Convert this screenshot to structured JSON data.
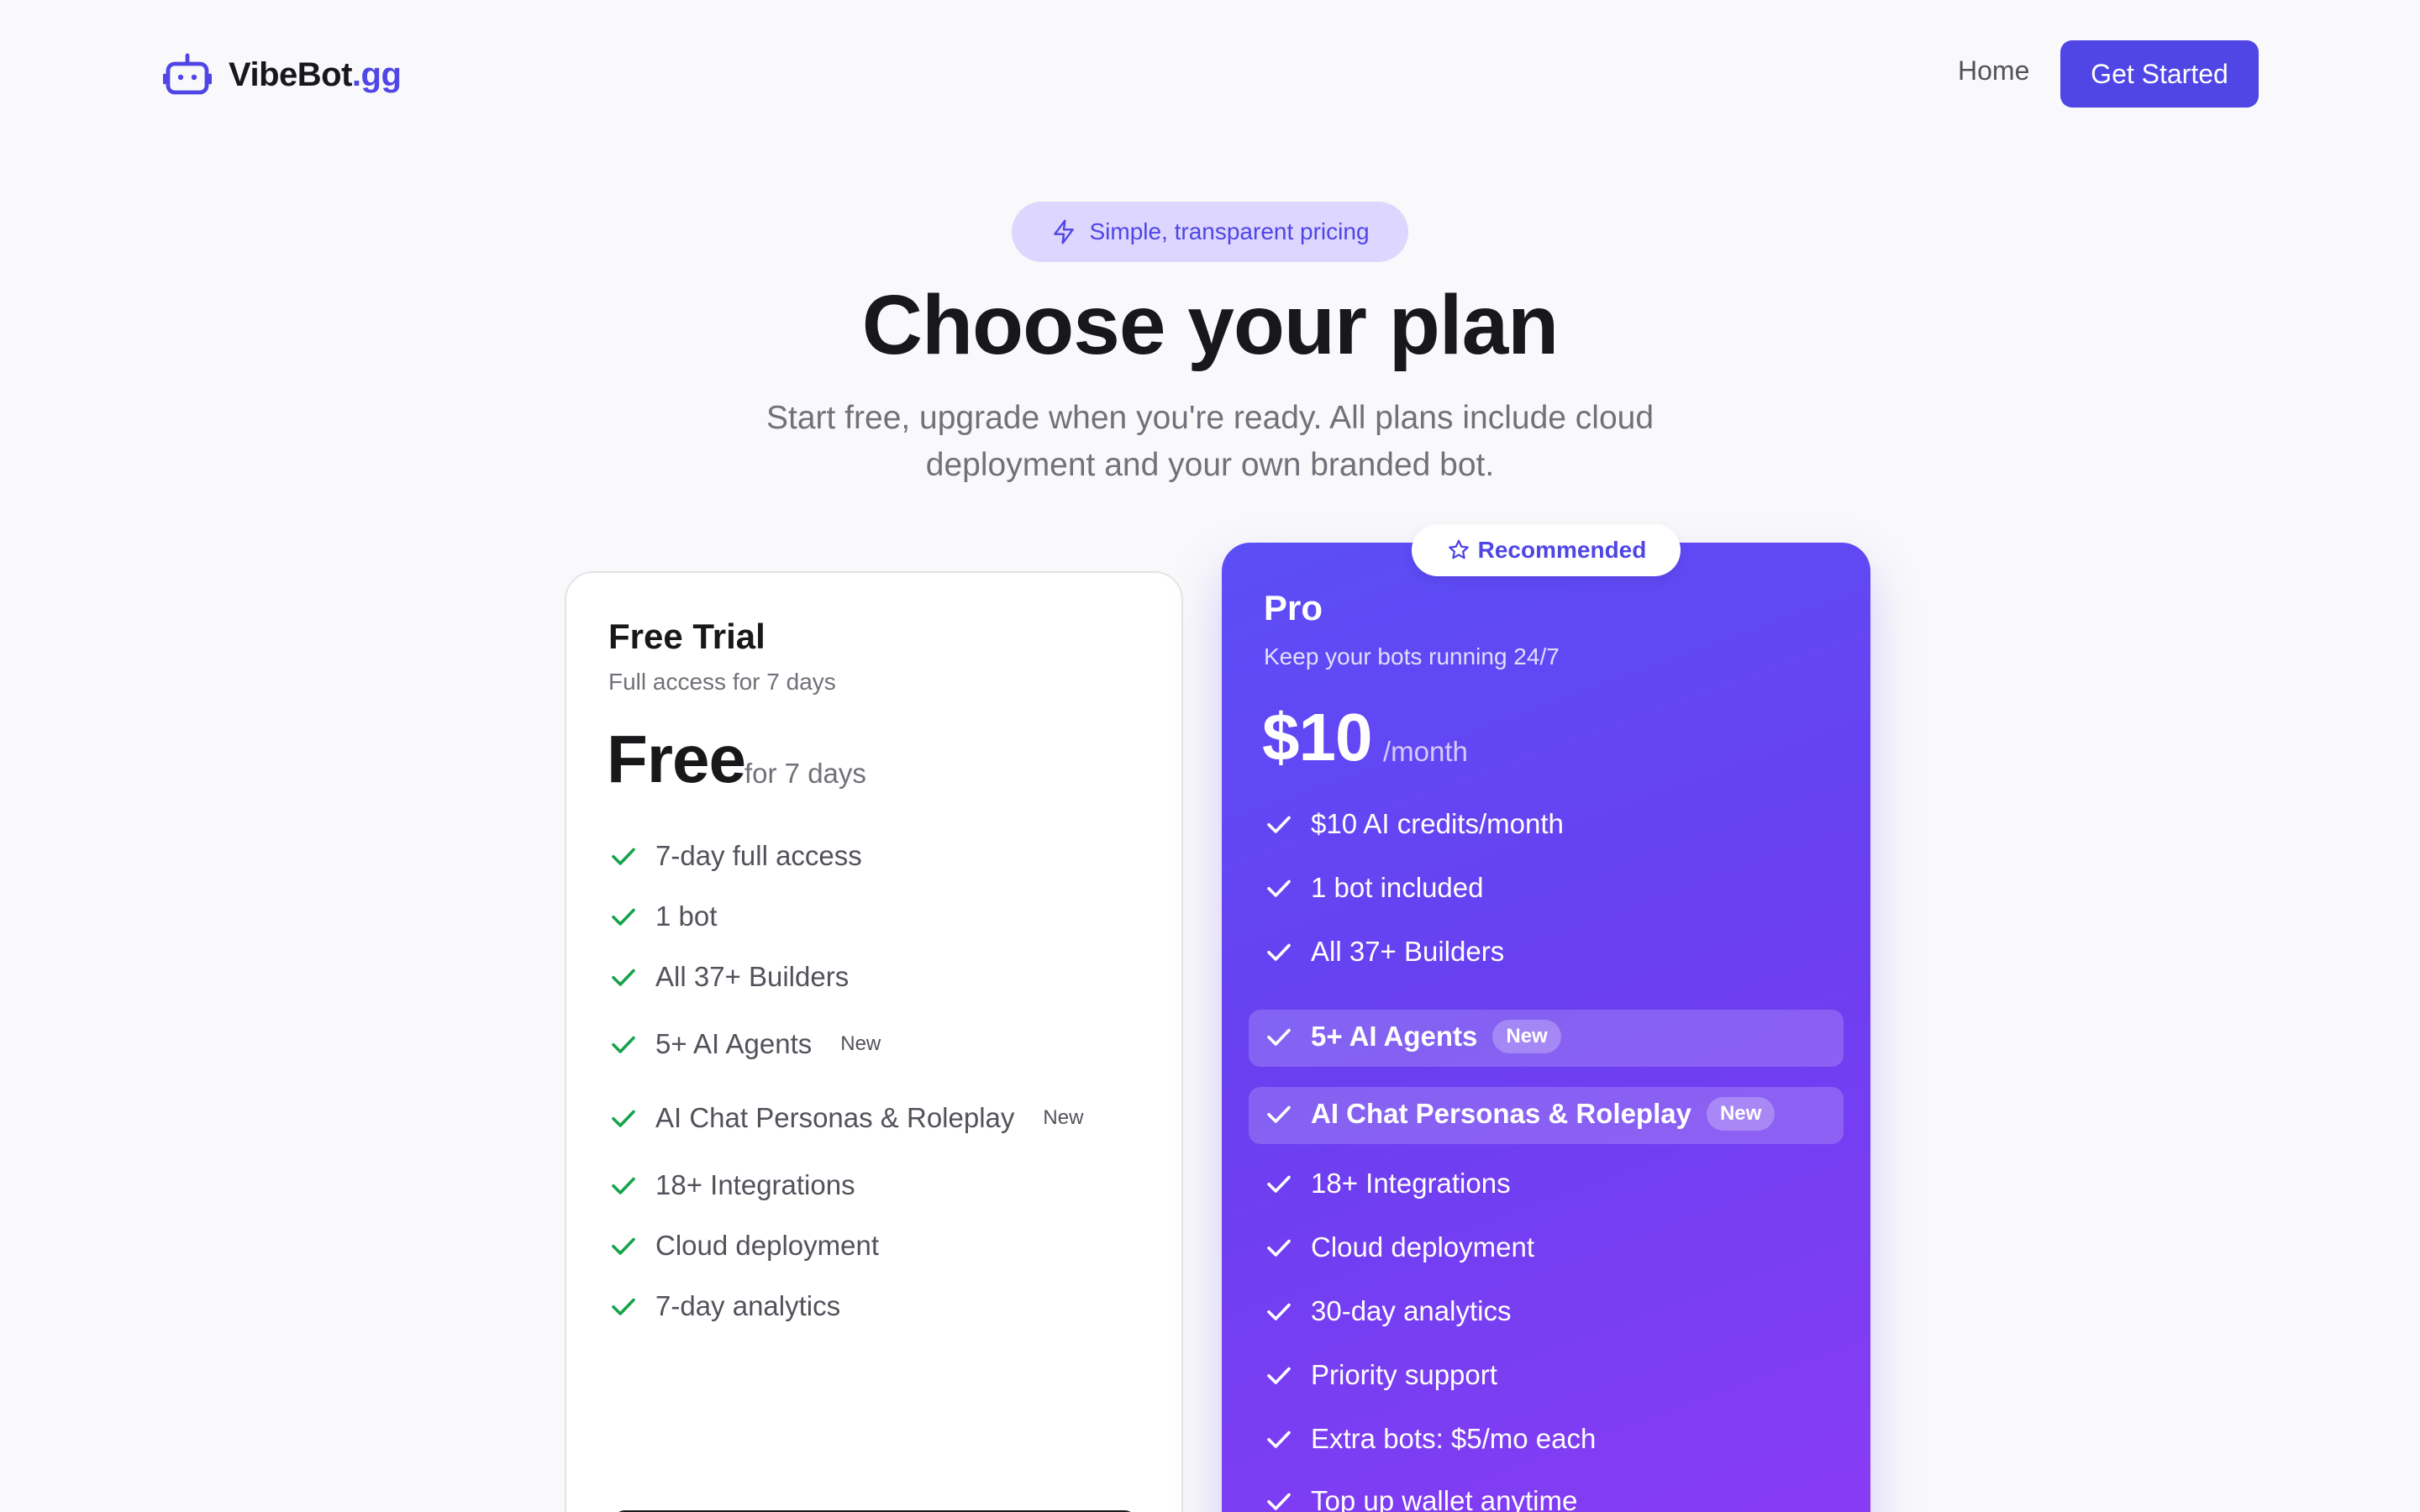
{
  "brand": {
    "name": "VibeBot",
    "tld": ".gg",
    "logo_icon": "robot-icon"
  },
  "nav": {
    "home": "Home",
    "cta": "Get Started"
  },
  "hero": {
    "pill": "Simple, transparent pricing",
    "pill_icon": "zap-icon",
    "title": "Choose your plan",
    "subtitle": "Start free, upgrade when you're ready. All plans include cloud deployment and your own branded bot."
  },
  "plans": {
    "free": {
      "name": "Free Trial",
      "description": "Full access for 7 days",
      "price": "Free",
      "price_suffix": "for 7 days",
      "features": [
        {
          "text": "7-day full access"
        },
        {
          "text": "1 bot"
        },
        {
          "text": "All 37+ Builders"
        },
        {
          "text": "5+ AI Agents",
          "tag": "New"
        },
        {
          "text": "AI Chat Personas & Roleplay",
          "tag": "New"
        },
        {
          "text": "18+ Integrations"
        },
        {
          "text": "Cloud deployment"
        },
        {
          "text": "7-day analytics"
        }
      ]
    },
    "pro": {
      "badge": "Recommended",
      "badge_icon": "star-icon",
      "name": "Pro",
      "description": "Keep your bots running 24/7",
      "price": "$10",
      "price_suffix": "/month",
      "features": [
        {
          "text": "$10 AI credits/month"
        },
        {
          "text": "1 bot included"
        },
        {
          "text": "All 37+ Builders"
        },
        {
          "text": "5+ AI Agents",
          "tag": "New"
        },
        {
          "text": "AI Chat Personas & Roleplay",
          "tag": "New"
        },
        {
          "text": "18+ Integrations"
        },
        {
          "text": "Cloud deployment"
        },
        {
          "text": "30-day analytics"
        },
        {
          "text": "Priority support"
        },
        {
          "text": "Extra bots: $5/mo each"
        },
        {
          "text": "Top up wallet anytime"
        }
      ]
    }
  },
  "colors": {
    "accent": "#4f46e5",
    "check_green": "#16a34a",
    "pro_gradient_start": "#5b4ef7",
    "pro_gradient_end": "#8b3cf5"
  }
}
